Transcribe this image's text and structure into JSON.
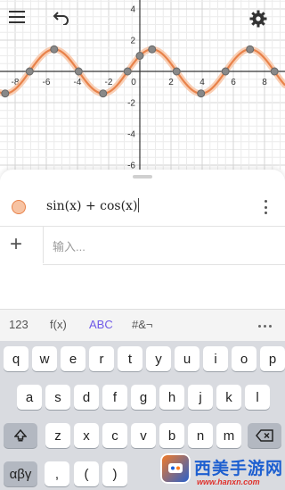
{
  "colors": {
    "curve": "#e8824a",
    "curve_halo": "#f7c3a3",
    "accent": "#6f59e8",
    "grid_minor": "#ececec",
    "grid_major": "#d6d6d6",
    "axis": "#333333"
  },
  "toolbar": {
    "menu_icon": "menu-icon",
    "undo_icon": "undo-icon",
    "settings_icon": "settings-icon"
  },
  "graph": {
    "x_ticks": [
      "-8",
      "-6",
      "-4",
      "-2",
      "0",
      "2",
      "4",
      "6",
      "8"
    ],
    "y_ticks": [
      "4",
      "2",
      "-2",
      "-4",
      "-6"
    ],
    "xlim": [
      -9,
      9
    ],
    "ylim": [
      -6.3,
      5
    ]
  },
  "algebra": {
    "expression": "sin(x) + cos(x)",
    "input_placeholder": "输入..."
  },
  "keyboard": {
    "tabs": [
      "123",
      "f(x)",
      "ABC",
      "#&¬"
    ],
    "active_tab": "ABC",
    "row1": [
      "q",
      "w",
      "e",
      "r",
      "t",
      "y",
      "u",
      "i",
      "o",
      "p"
    ],
    "row2": [
      "a",
      "s",
      "d",
      "f",
      "g",
      "h",
      "j",
      "k",
      "l"
    ],
    "row3": [
      "z",
      "x",
      "c",
      "v",
      "b",
      "n",
      "m"
    ],
    "row4": [
      "αβγ",
      ",",
      "(",
      ")"
    ]
  },
  "watermark": {
    "text": "西美手游网",
    "url": "www.hanxn.com"
  }
}
